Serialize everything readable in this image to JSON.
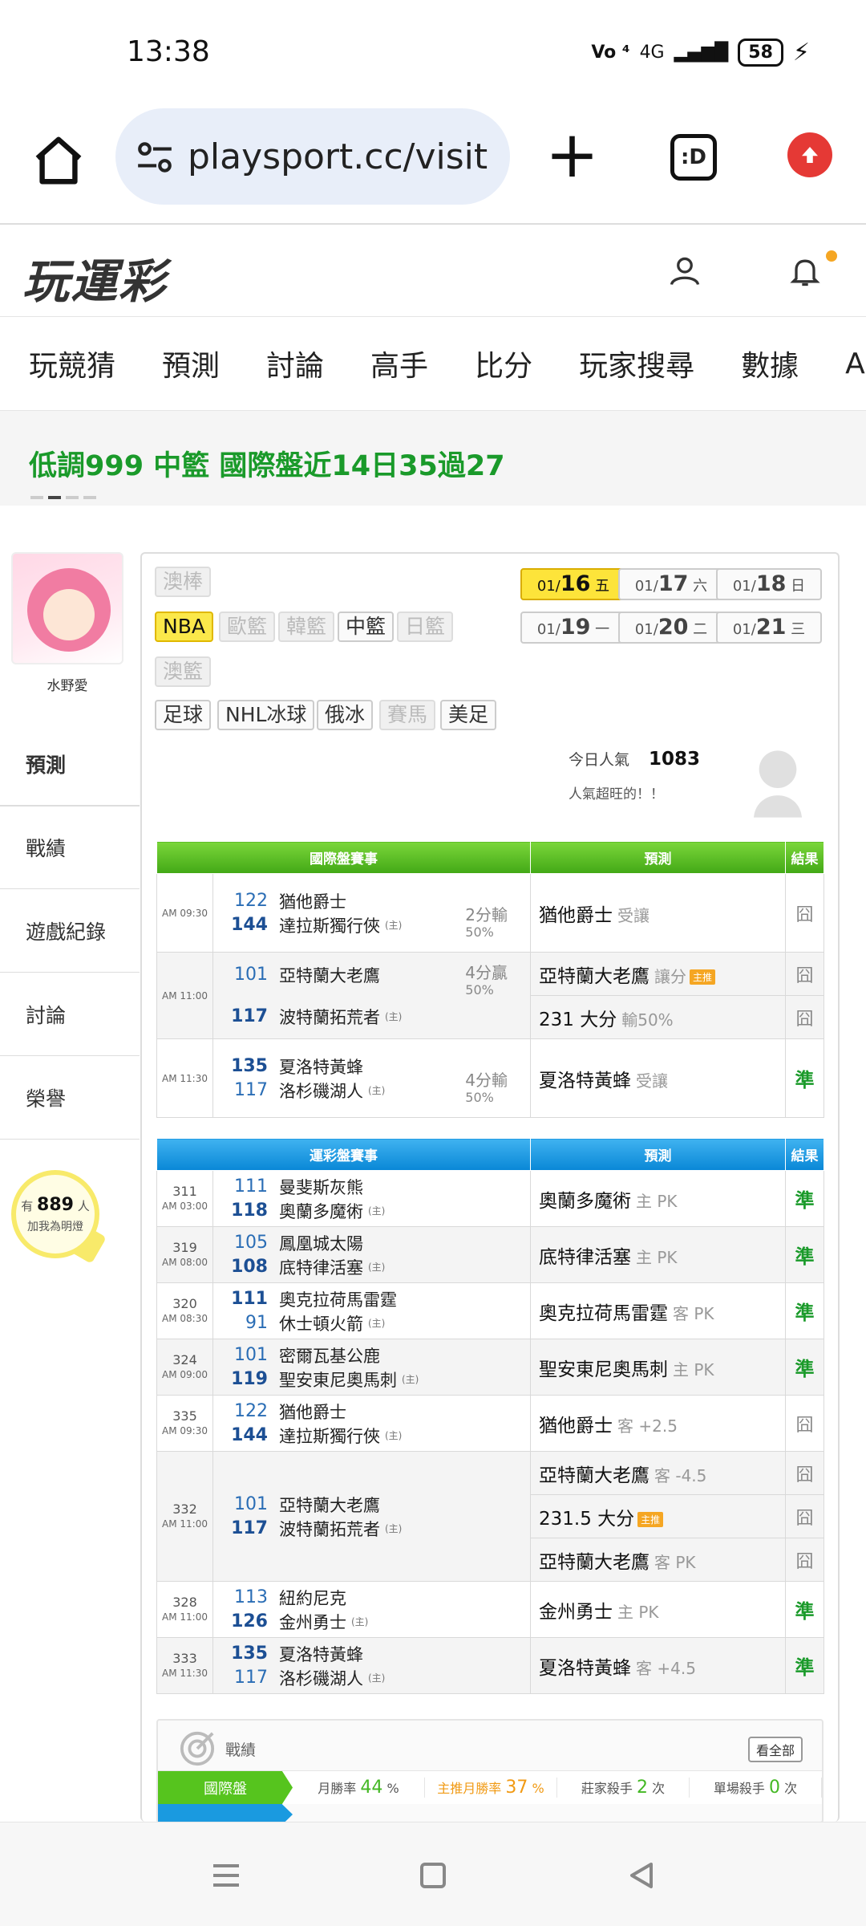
{
  "status_bar": {
    "time": "13:38",
    "network": "4G",
    "battery": "58"
  },
  "browser": {
    "url": "playsport.cc/visit",
    "tabs_label": ":D"
  },
  "site": {
    "logo": "玩運彩"
  },
  "nav": {
    "items": [
      "玩競猜",
      "預測",
      "討論",
      "高手",
      "比分",
      "玩家搜尋",
      "數據",
      "APP"
    ]
  },
  "marquee": {
    "text": "低調999 中籃 國際盤近14日35過27"
  },
  "profile": {
    "name": "水野愛"
  },
  "side_menu": {
    "items": [
      "預測",
      "戰績",
      "遊戲紀錄",
      "討論",
      "榮譽"
    ]
  },
  "fans": {
    "prefix": "有",
    "count": "889",
    "suffix": "人",
    "cta": "加我為明燈"
  },
  "leagues": {
    "row1": [
      "澳棒"
    ],
    "row2": [
      "NBA",
      "歐籃",
      "韓籃",
      "中籃",
      "日籃"
    ],
    "row3": [
      "澳籃"
    ],
    "row4": [
      "足球",
      "NHL冰球",
      "俄冰",
      "賽馬",
      "美足"
    ]
  },
  "dates": [
    {
      "md": "01/",
      "d": "16",
      "w": "五"
    },
    {
      "md": "01/",
      "d": "17",
      "w": "六"
    },
    {
      "md": "01/",
      "d": "18",
      "w": "日"
    },
    {
      "md": "01/",
      "d": "19",
      "w": "一"
    },
    {
      "md": "01/",
      "d": "20",
      "w": "二"
    },
    {
      "md": "01/",
      "d": "21",
      "w": "三"
    }
  ],
  "popularity": {
    "label": "今日人氣",
    "count": "1083",
    "note": "人氣超旺的！！"
  },
  "intl_table": {
    "headers": [
      "國際盤賽事",
      "預測",
      "結果"
    ],
    "rows": [
      {
        "time": "AM 09:30",
        "n1": "122",
        "t1": "猶他爵士",
        "n2": "144",
        "t2": "達拉斯獨行俠",
        "home": "(主)",
        "res1": "2分輸",
        "res2": "50%",
        "pred": "猶他爵士",
        "pred_s": "受讓",
        "result": "囧"
      },
      {
        "time": "AM 11:00",
        "n1": "101",
        "t1": "亞特蘭大老鷹",
        "n2": "117",
        "t2": "波特蘭拓荒者",
        "home": "(主)",
        "res1": "4分贏",
        "res2": "50%",
        "pred": "亞特蘭大老鷹",
        "pred_s": "讓分",
        "pred_tag": "主推",
        "result": "囧",
        "pred2": "231 大分",
        "pred2_s": "輸50%",
        "result2": "囧"
      },
      {
        "time": "AM 11:30",
        "n1": "135",
        "t1": "夏洛特黃蜂",
        "n2": "117",
        "t2": "洛杉磯湖人",
        "home": "(主)",
        "res1": "4分輸",
        "res2": "50%",
        "pred": "夏洛特黃蜂",
        "pred_s": "受讓",
        "result": "準"
      }
    ]
  },
  "lottery_table": {
    "headers": [
      "運彩盤賽事",
      "預測",
      "結果"
    ],
    "rows": [
      {
        "no": "311",
        "time": "AM 03:00",
        "n1": "111",
        "t1": "曼斐斯灰熊",
        "n2": "118",
        "t2": "奧蘭多魔術",
        "home": "(主)",
        "pred": "奧蘭多魔術",
        "pred_s": "主 PK",
        "result": "準"
      },
      {
        "no": "319",
        "time": "AM 08:00",
        "n1": "105",
        "t1": "鳳凰城太陽",
        "n2": "108",
        "t2": "底特律活塞",
        "home": "(主)",
        "pred": "底特律活塞",
        "pred_s": "主 PK",
        "result": "準"
      },
      {
        "no": "320",
        "time": "AM 08:30",
        "n1": "111",
        "t1": "奧克拉荷馬雷霆",
        "n2": "91",
        "t2": "休士頓火箭",
        "home": "(主)",
        "pred": "奧克拉荷馬雷霆",
        "pred_s": "客 PK",
        "result": "準"
      },
      {
        "no": "324",
        "time": "AM 09:00",
        "n1": "101",
        "t1": "密爾瓦基公鹿",
        "n2": "119",
        "t2": "聖安東尼奧馬刺",
        "home": "(主)",
        "pred": "聖安東尼奧馬刺",
        "pred_s": "主 PK",
        "result": "準"
      },
      {
        "no": "335",
        "time": "AM 09:30",
        "n1": "122",
        "t1": "猶他爵士",
        "n2": "144",
        "t2": "達拉斯獨行俠",
        "home": "(主)",
        "pred": "猶他爵士",
        "pred_s": "客 +2.5",
        "result": "囧"
      },
      {
        "no": "332",
        "time": "AM 11:00",
        "n1": "101",
        "t1": "亞特蘭大老鷹",
        "n2": "117",
        "t2": "波特蘭拓荒者",
        "home": "(主)",
        "pred": "亞特蘭大老鷹",
        "pred_s": "客 -4.5",
        "result": "囧",
        "pred2": "231.5 大分",
        "pred2_tag": "主推",
        "result2": "囧",
        "pred3": "亞特蘭大老鷹",
        "pred3_s": "客 PK",
        "result3": "囧"
      },
      {
        "no": "328",
        "time": "AM 11:00",
        "n1": "113",
        "t1": "紐約尼克",
        "n2": "126",
        "t2": "金州勇士",
        "home": "(主)",
        "pred": "金州勇士",
        "pred_s": "主 PK",
        "result": "準"
      },
      {
        "no": "333",
        "time": "AM 11:30",
        "n1": "135",
        "t1": "夏洛特黃蜂",
        "n2": "117",
        "t2": "洛杉磯湖人",
        "home": "(主)",
        "pred": "夏洛特黃蜂",
        "pred_s": "客 +4.5",
        "result": "準"
      }
    ]
  },
  "record": {
    "title": "戰績",
    "see_all": "看全部",
    "label": "國際盤",
    "monthly_rate_label": "月勝率",
    "monthly_rate": "44",
    "pct": "%",
    "main_rate_label": "主推月勝率",
    "main_rate": "37",
    "dealer_label": "莊家殺手",
    "dealer": "2",
    "times": "次",
    "single_label": "單場殺手",
    "single": "0"
  },
  "colors": {
    "accent_green": "#1a9a2a",
    "brand_green": "#42a816",
    "brand_blue": "#0987d6",
    "highlight": "#fde43a"
  }
}
